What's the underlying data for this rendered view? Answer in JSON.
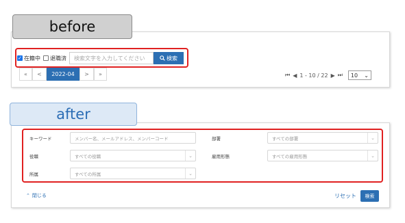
{
  "before": {
    "title": "before",
    "filters": {
      "active_label": "在籍中",
      "active_checked": true,
      "retired_label": "退職済",
      "retired_checked": false
    },
    "search": {
      "placeholder": "検索文字を入力してください",
      "button_label": "検索"
    },
    "pager": {
      "first": "«",
      "prev": "<",
      "current": "2022-04",
      "next": ">",
      "last": "»"
    },
    "pagination": {
      "first_icon": "first-page-icon",
      "prev_icon": "prev-page-icon",
      "range": "1 - 10 / 22",
      "next_icon": "next-page-icon",
      "last_icon": "last-page-icon",
      "per_page": "10"
    }
  },
  "after": {
    "title": "after",
    "fields": {
      "keyword_label": "キーワード",
      "keyword_placeholder": "メンバー名、メールアドレス、メンバーコード",
      "department_label": "部署",
      "department_value": "すべての部署",
      "position_label": "役職",
      "position_value": "すべての役職",
      "employment_label": "雇用形態",
      "employment_value": "すべての雇用形態",
      "affiliation_label": "所属",
      "affiliation_value": "すべての所属"
    },
    "close_label": "閉じる",
    "reset_label": "リセット",
    "search_label": "検索"
  },
  "colors": {
    "accent": "#2c6fb3",
    "highlight": "#e02020"
  }
}
